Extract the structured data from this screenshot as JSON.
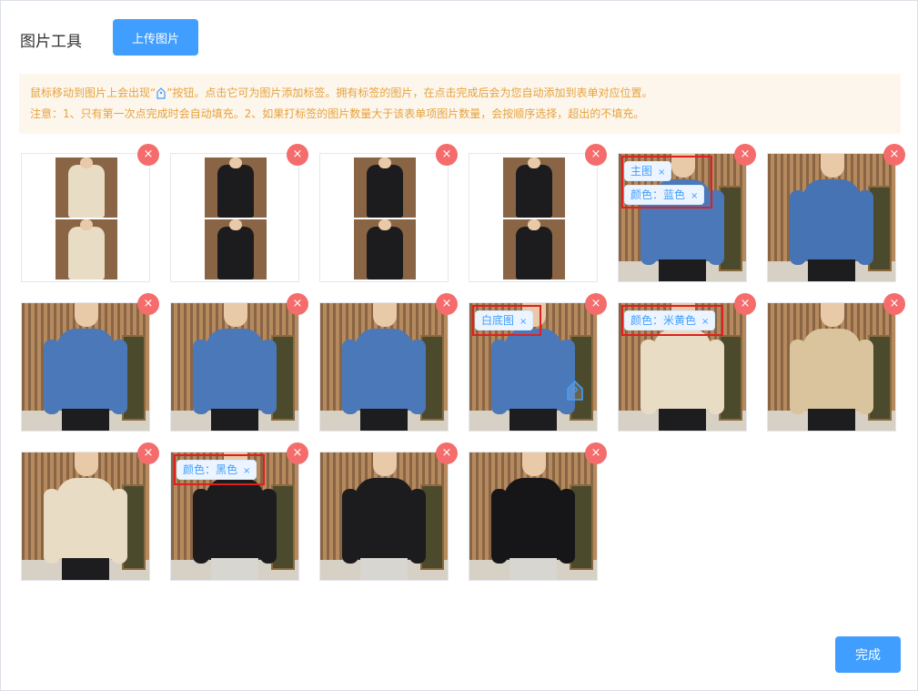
{
  "header": {
    "title": "图片工具",
    "upload_label": "上传图片"
  },
  "notice": {
    "line1_before": "鼠标移动到图片上会出现“",
    "line1_after": "”按钮。点击它可为图片添加标签。拥有标签的图片，在点击完成后会为您自动添加到表单对应位置。",
    "line2": "注意：1、只有第一次点完成时会自动填充。2、如果打标签的图片数量大于该表单项图片数量，会按顺序选择，超出的不填充。"
  },
  "colors": {
    "primary": "#409eff",
    "delete": "#f56c6c",
    "notice_bg": "#fdf6ec",
    "notice_text": "#e6a23c",
    "highlight": "#e02020"
  },
  "delete_icon": "×",
  "tag_close": "×",
  "images": [
    {
      "kind": "collage",
      "sweater": "cream",
      "tags": []
    },
    {
      "kind": "collage",
      "sweater": "black",
      "tags": []
    },
    {
      "kind": "collage",
      "sweater": "black",
      "tags": []
    },
    {
      "kind": "collage",
      "sweater": "black",
      "tags": []
    },
    {
      "kind": "photo",
      "sweater": "blue",
      "tags": [
        "主图",
        "颜色：蓝色"
      ]
    },
    {
      "kind": "photo",
      "sweater": "blue-back",
      "tags": []
    },
    {
      "kind": "photo",
      "sweater": "blue",
      "tags": []
    },
    {
      "kind": "photo",
      "sweater": "blue",
      "tags": []
    },
    {
      "kind": "photo",
      "sweater": "blue",
      "tags": []
    },
    {
      "kind": "photo",
      "sweater": "blue",
      "tags": [
        "白底图"
      ],
      "hover_tag_button": true
    },
    {
      "kind": "photo",
      "sweater": "cream",
      "tags": [
        "颜色：米黄色"
      ]
    },
    {
      "kind": "photo",
      "sweater": "cream-back",
      "tags": []
    },
    {
      "kind": "photo",
      "sweater": "cream",
      "tags": []
    },
    {
      "kind": "photo",
      "sweater": "black",
      "tags": [
        "颜色：黑色"
      ]
    },
    {
      "kind": "photo",
      "sweater": "black",
      "tags": []
    },
    {
      "kind": "photo",
      "sweater": "black-back",
      "tags": []
    }
  ],
  "footer": {
    "finish_label": "完成"
  }
}
